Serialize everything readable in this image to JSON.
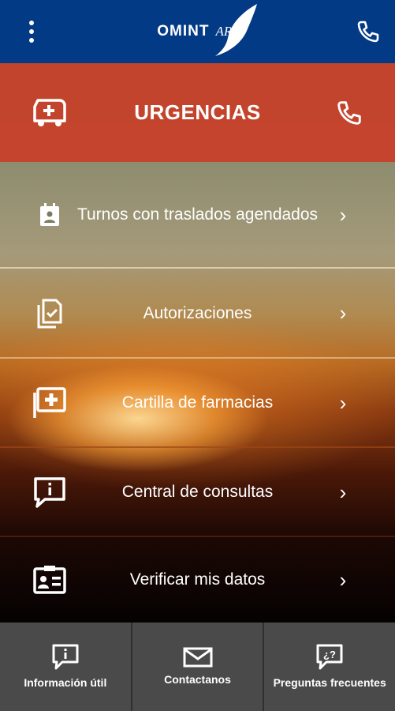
{
  "header": {
    "logo_omint": "OMINT",
    "logo_art": "ART",
    "menu_icon": "more-vertical-icon",
    "phone_icon": "phone-icon"
  },
  "emergency": {
    "label": "URGENCIAS",
    "left_icon": "ambulance-icon",
    "right_icon": "phone-icon",
    "color": "#c83e28"
  },
  "menu": {
    "items": [
      {
        "label": "Turnos con traslados agendados",
        "icon": "calendar-person-icon"
      },
      {
        "label": "Autorizaciones",
        "icon": "document-check-icon"
      },
      {
        "label": "Cartilla de farmacias",
        "icon": "pharmacy-cross-icon"
      },
      {
        "label": "Central de consultas",
        "icon": "chat-info-icon"
      },
      {
        "label": "Verificar mis datos",
        "icon": "id-card-icon"
      }
    ],
    "chevron": "›"
  },
  "bottom_nav": {
    "tabs": [
      {
        "label": "Información útil",
        "icon": "info-bubble-icon"
      },
      {
        "label": "Contactanos",
        "icon": "envelope-icon"
      },
      {
        "label": "Preguntas frecuentes",
        "icon": "question-bubble-icon"
      }
    ]
  },
  "colors": {
    "header_bg": "#033a86",
    "bottom_bg": "#4a4a4a"
  }
}
